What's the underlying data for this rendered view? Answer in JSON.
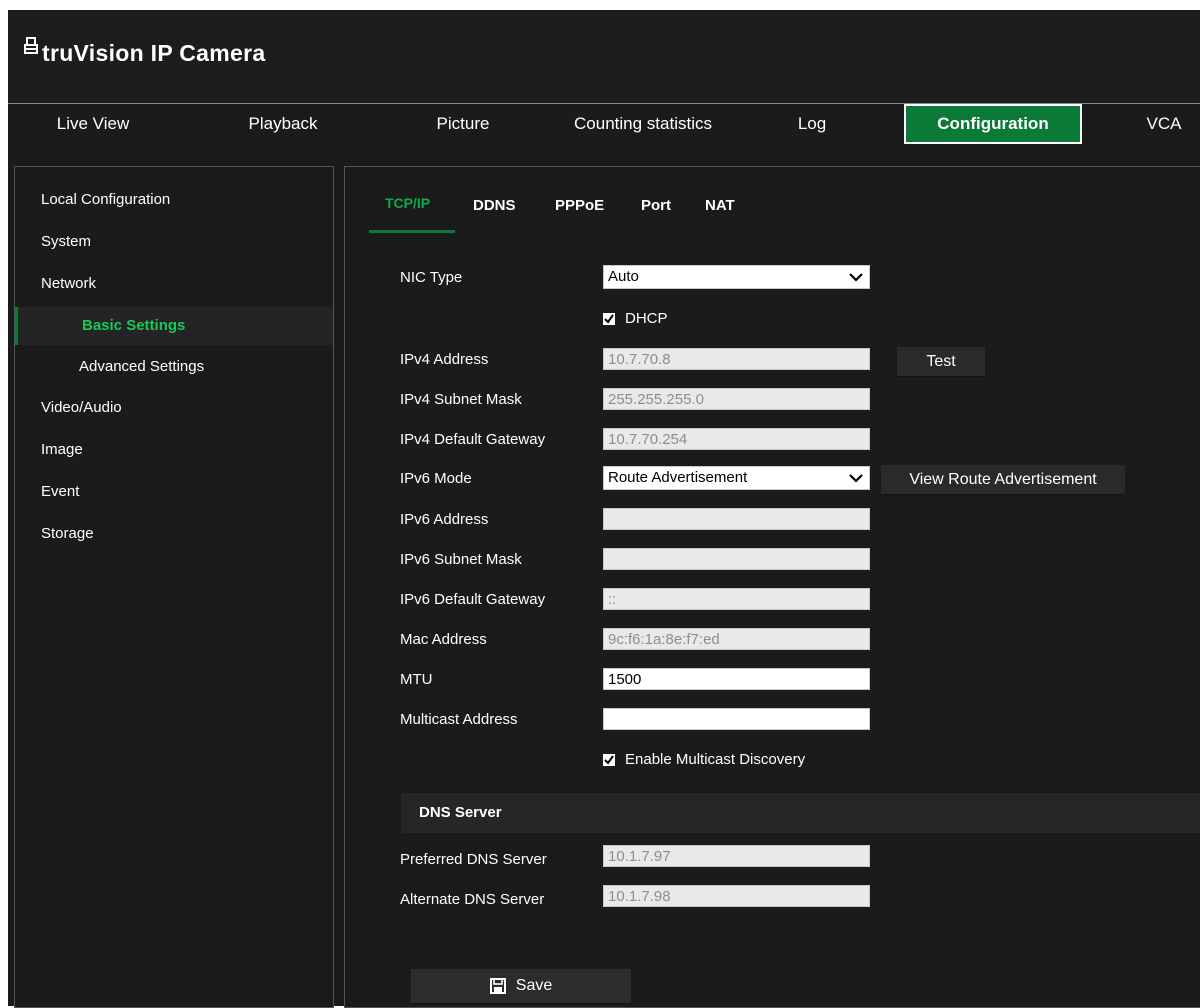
{
  "app": {
    "title": "truVision IP Camera"
  },
  "nav": [
    {
      "label": "Live View"
    },
    {
      "label": "Playback"
    },
    {
      "label": "Picture"
    },
    {
      "label": "Counting statistics"
    },
    {
      "label": "Log"
    },
    {
      "label": "Configuration",
      "active": true
    },
    {
      "label": "VCA"
    }
  ],
  "sidebar": {
    "items": [
      {
        "label": "Local Configuration"
      },
      {
        "label": "System"
      },
      {
        "label": "Network"
      },
      {
        "label": "Basic Settings",
        "active": true
      },
      {
        "label": "Advanced Settings"
      },
      {
        "label": "Video/Audio"
      },
      {
        "label": "Image"
      },
      {
        "label": "Event"
      },
      {
        "label": "Storage"
      }
    ]
  },
  "tabs": [
    {
      "label": "TCP/IP",
      "active": true
    },
    {
      "label": "DDNS"
    },
    {
      "label": "PPPoE"
    },
    {
      "label": "Port"
    },
    {
      "label": "NAT"
    }
  ],
  "form": {
    "nic_type": {
      "label": "NIC Type",
      "value": "Auto"
    },
    "dhcp": {
      "label": "DHCP",
      "checked": true
    },
    "ipv4_address": {
      "label": "IPv4 Address",
      "value": "10.7.70.8"
    },
    "test_button": "Test",
    "ipv4_subnet": {
      "label": "IPv4 Subnet Mask",
      "value": "255.255.255.0"
    },
    "ipv4_gateway": {
      "label": "IPv4 Default Gateway",
      "value": "10.7.70.254"
    },
    "ipv6_mode": {
      "label": "IPv6 Mode",
      "value": "Route Advertisement"
    },
    "view_route_button": "View Route Advertisement",
    "ipv6_address": {
      "label": "IPv6 Address",
      "value": ""
    },
    "ipv6_subnet": {
      "label": "IPv6 Subnet Mask",
      "value": ""
    },
    "ipv6_gateway": {
      "label": "IPv6 Default Gateway",
      "value": "::"
    },
    "mac_address": {
      "label": "Mac Address",
      "value": "9c:f6:1a:8e:f7:ed"
    },
    "mtu": {
      "label": "MTU",
      "value": "1500"
    },
    "multicast_address": {
      "label": "Multicast Address",
      "value": ""
    },
    "multicast_discovery": {
      "label": "Enable Multicast Discovery",
      "checked": true
    }
  },
  "dns": {
    "title": "DNS Server",
    "preferred": {
      "label": "Preferred DNS Server",
      "value": "10.1.7.97"
    },
    "alternate": {
      "label": "Alternate DNS Server",
      "value": "10.1.7.98"
    }
  },
  "save_button": "Save",
  "colors": {
    "accent": "#0b7a36",
    "active_text": "#17c75a",
    "background": "#1b1b1b"
  }
}
